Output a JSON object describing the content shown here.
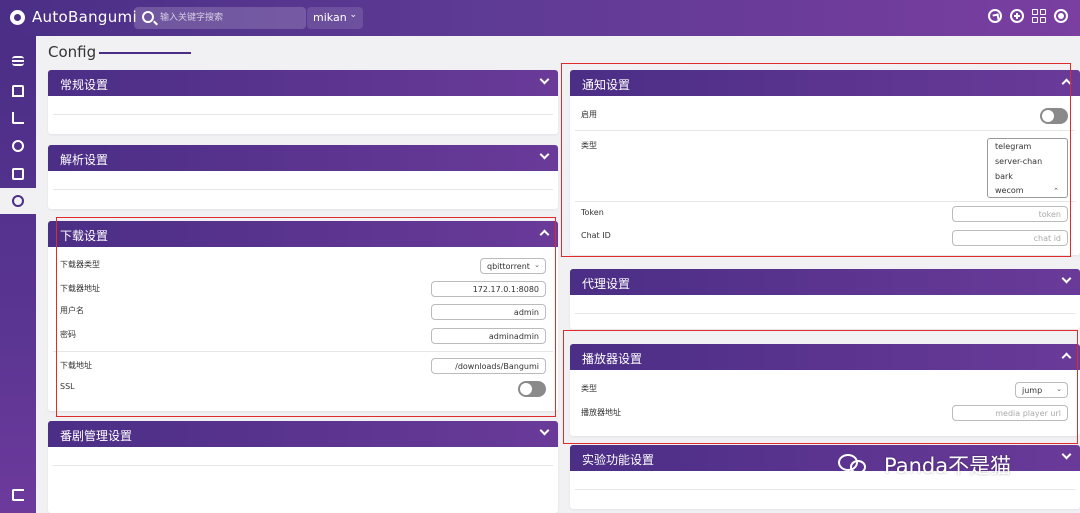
{
  "header": {
    "app_title": "AutoBangumi",
    "search_placeholder": "输入关键字搜索",
    "source": "mikan"
  },
  "page": {
    "title": "Config"
  },
  "sections": {
    "general": {
      "title": "常规设置"
    },
    "parser": {
      "title": "解析设置"
    },
    "downloader": {
      "title": "下载设置",
      "type_label": "下载器类型",
      "type_value": "qbittorrent",
      "host_label": "下载器地址",
      "host_value": "172.17.0.1:8080",
      "username_label": "用户名",
      "username_value": "admin",
      "password_label": "密码",
      "password_value": "adminadmin",
      "path_label": "下载地址",
      "path_value": "/downloads/Bangumi",
      "ssl_label": "SSL"
    },
    "manage": {
      "title": "番剧管理设置"
    },
    "notification": {
      "title": "通知设置",
      "enable_label": "启用",
      "type_label": "类型",
      "type_options": [
        "telegram",
        "server-chan",
        "bark",
        "wecom"
      ],
      "token_label": "Token",
      "token_placeholder": "token",
      "chat_id_label": "Chat ID",
      "chat_id_placeholder": "chat id"
    },
    "proxy": {
      "title": "代理设置"
    },
    "player": {
      "title": "播放器设置",
      "type_label": "类型",
      "type_value": "jump",
      "url_label": "播放器地址",
      "url_placeholder": "media player url"
    },
    "experimental": {
      "title": "实验功能设置"
    }
  },
  "watermark": "Panda不是猫",
  "colors": {
    "primary": "#4b2e86",
    "accent": "#6a3a99",
    "highlight": "#e02b2b"
  }
}
